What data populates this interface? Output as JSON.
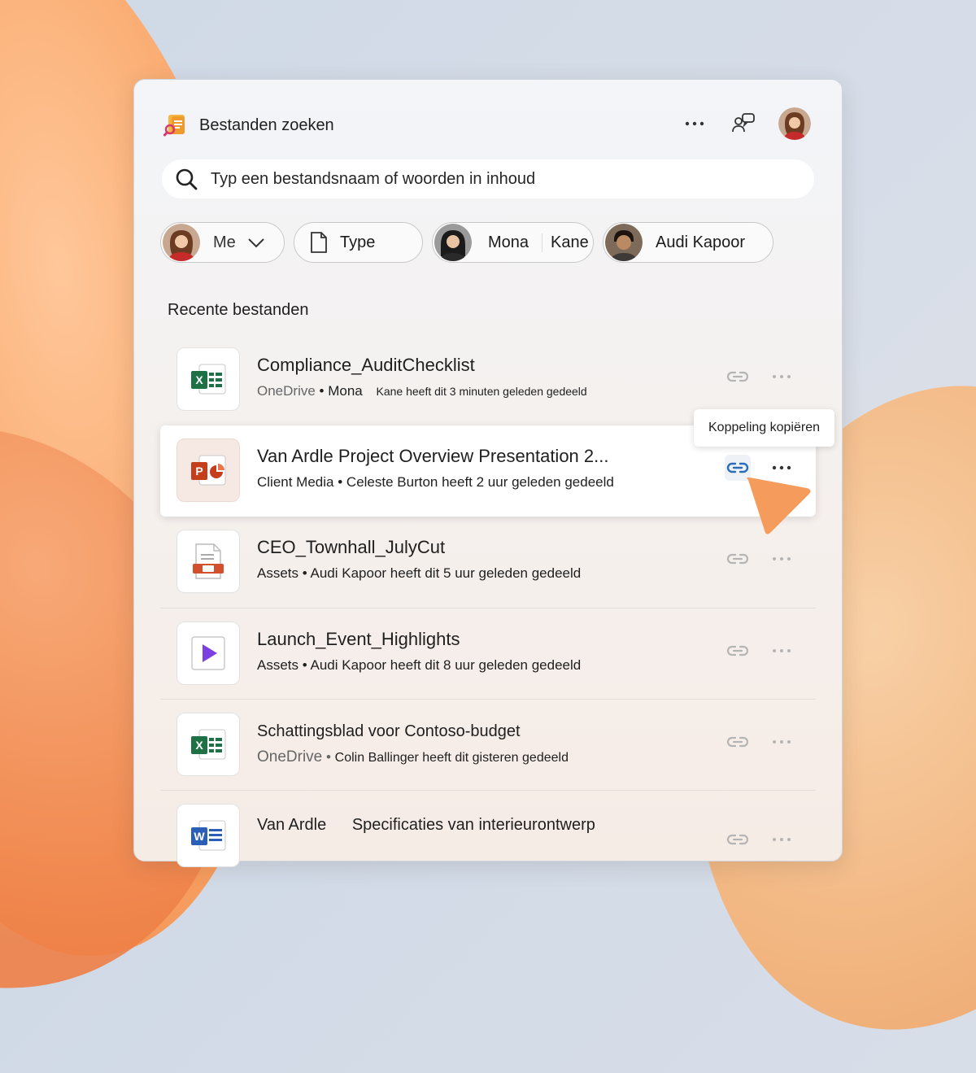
{
  "app": {
    "title": "Bestanden zoeken"
  },
  "search": {
    "placeholder": "Typ een bestandsnaam of woorden in inhoud"
  },
  "filters": [
    {
      "label": "Me"
    },
    {
      "label": "Type"
    },
    {
      "label_first": "Mona",
      "label_last": "Kane"
    },
    {
      "label": "Audi Kapoor"
    }
  ],
  "section": {
    "title": "Recente bestanden"
  },
  "files": [
    {
      "name": "Compliance_AuditChecklist",
      "location": "OneDrive",
      "shared_by": "Mona",
      "shared_info": "Kane heeft dit 3 minuten geleden gedeeld",
      "type": "excel"
    },
    {
      "name": "Van Ardle Project Overview Presentation 2...",
      "location": "Client Media",
      "shared_info": "Celeste Burton heeft 2 uur geleden gedeeld",
      "type": "powerpoint"
    },
    {
      "name": "CEO_Townhall_JulyCut",
      "location": "Assets",
      "shared_info": "Audi Kapoor heeft dit 5 uur geleden gedeeld",
      "type": "video-file"
    },
    {
      "name": "Launch_Event_Highlights",
      "location": "Assets",
      "shared_info": "Audi Kapoor heeft dit 8 uur geleden gedeeld",
      "type": "video"
    },
    {
      "name": "Schattingsblad voor Contoso-budget",
      "location": "OneDrive",
      "shared_info": "Colin Ballinger heeft dit gisteren gedeeld",
      "type": "excel"
    },
    {
      "name_first": "Van Ardle",
      "name_second": "Specificaties van interieurontwerp",
      "type": "word"
    }
  ],
  "tooltip": {
    "text": "Koppeling kopiëren"
  },
  "colors": {
    "excel": "#1e7145",
    "powerpoint": "#c43e1c",
    "video": "#7b3fe4",
    "word": "#2b5eb7",
    "accent": "#2a6ebb",
    "cursor": "#f59b5c"
  },
  "icons": {
    "search": "search-icon",
    "more": "more-icon",
    "people": "people-chat-icon",
    "link": "link-icon",
    "chevron": "chevron-down-icon",
    "document": "document-icon"
  }
}
